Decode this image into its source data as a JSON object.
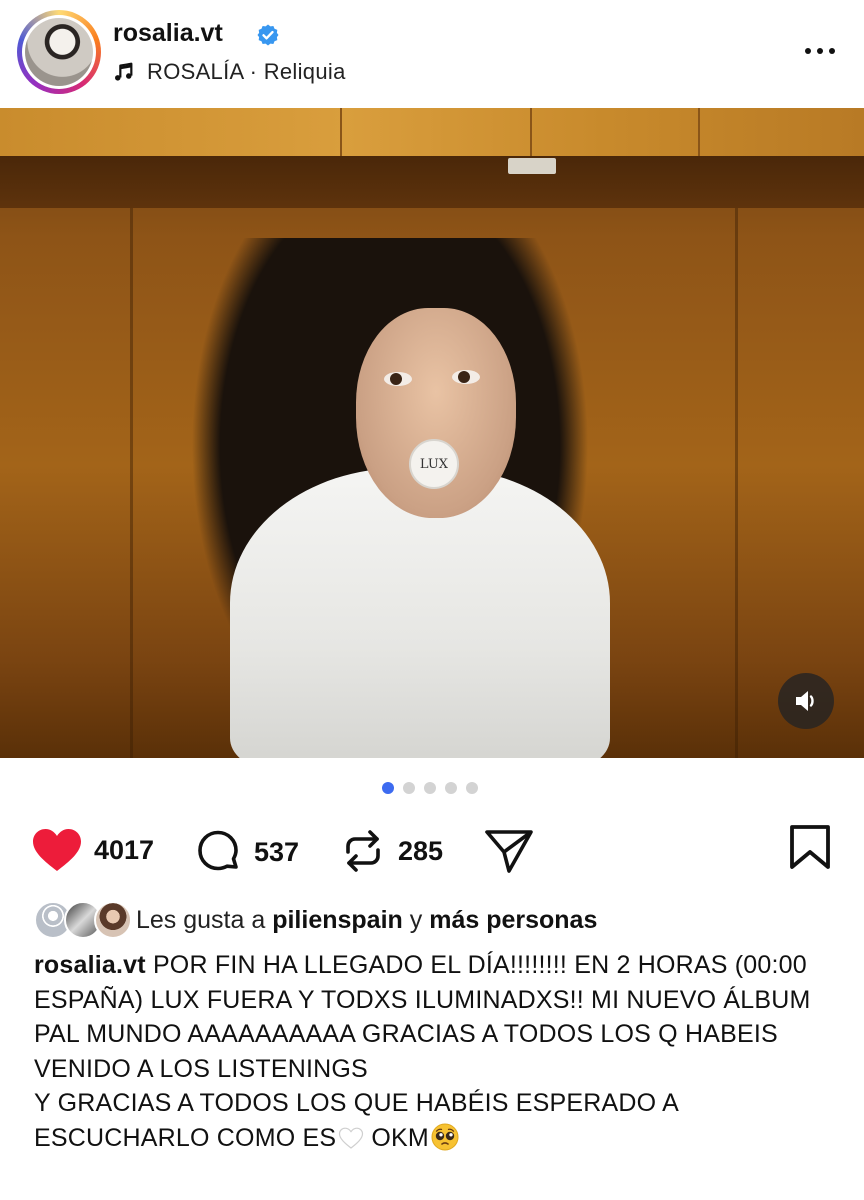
{
  "header": {
    "username": "rosalia.vt",
    "music": "ROSALÍA · Reliquia"
  },
  "photo": {
    "pacifier_text": "LUX"
  },
  "carousel": {
    "count": 5,
    "active_index": 0
  },
  "actions": {
    "likes": "4017",
    "comments": "537",
    "reposts": "285"
  },
  "likes_line": {
    "prefix": "Les gusta a",
    "user": "pilienspain",
    "joiner": "y",
    "others": "más personas"
  },
  "caption": {
    "user": "rosalia.vt",
    "para1": "POR FIN HA LLEGADO EL DÍA!!!!!!!! EN 2 HORAS (00:00 ESPAÑA) LUX FUERA Y TODXS ILUMINADXS!! MI NUEVO ÁLBUM PAL MUNDO AAAAAAAAAA GRACIAS A TODOS LOS Q HABEIS VENIDO A LOS LISTENINGS",
    "para2_a": "Y GRACIAS A TODOS LOS QUE HABÉIS ESPERADO A ESCUCHARLO COMO ES",
    "para2_b": " OKM"
  },
  "colors": {
    "heart": "#ed1c3a",
    "verified": "#3897f0",
    "active_dot": "#3d6bf0"
  }
}
